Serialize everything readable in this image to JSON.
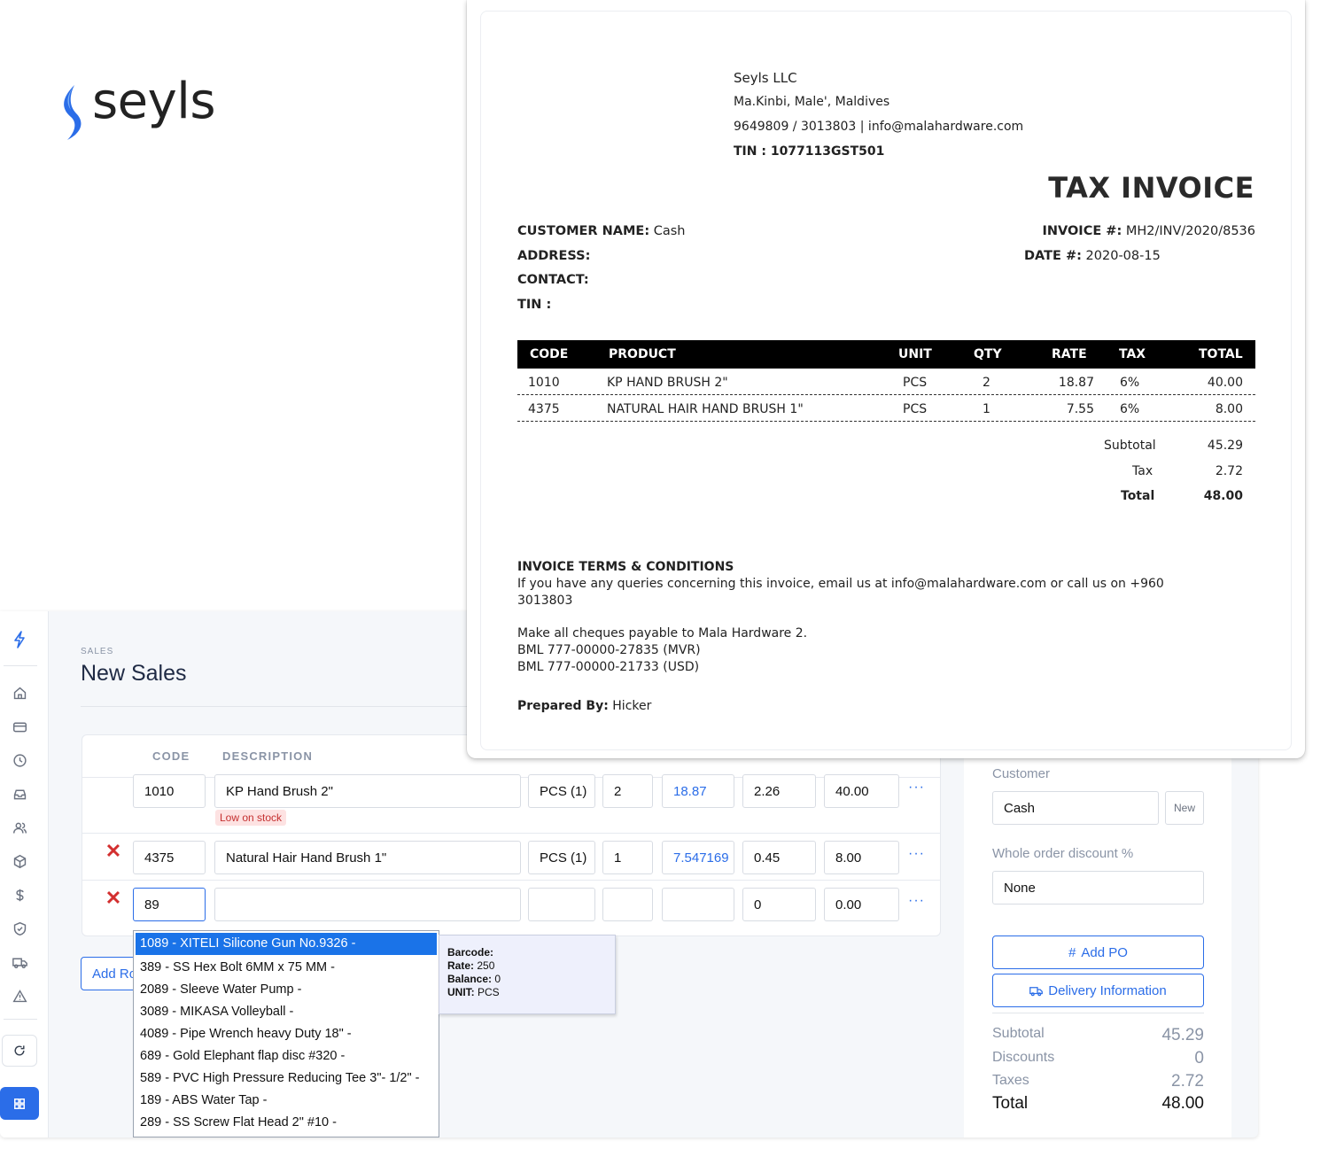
{
  "invoice": {
    "logo_text": "seyls",
    "company": "Seyls LLC",
    "address": "Ma.Kinbi, Male', Maldives",
    "contact_line": "9649809 / 3013803 | info@malahardware.com",
    "tin_label": "TIN :",
    "tin_value": "1077113GST501",
    "title": "TAX INVOICE",
    "customer_name_label": "CUSTOMER NAME:",
    "customer_name": "Cash",
    "address_label": "ADDRESS:",
    "contact_label": "CONTACT:",
    "tin2_label": "TIN :",
    "invoice_no_label": "INVOICE #:",
    "invoice_no": "MH2/INV/2020/8536",
    "date_label": "DATE #:",
    "date": "2020-08-15",
    "columns": [
      "CODE",
      "PRODUCT",
      "UNIT",
      "QTY",
      "RATE",
      "TAX",
      "TOTAL"
    ],
    "rows": [
      {
        "code": "1010",
        "product": "KP HAND BRUSH 2\"",
        "unit": "PCS",
        "qty": "2",
        "rate": "18.87",
        "tax": "6%",
        "total": "40.00"
      },
      {
        "code": "4375",
        "product": "NATURAL HAIR HAND BRUSH 1\"",
        "unit": "PCS",
        "qty": "1",
        "rate": "7.55",
        "tax": "6%",
        "total": "8.00"
      }
    ],
    "subtotal_label": "Subtotal",
    "subtotal": "45.29",
    "tax_label": "Tax",
    "tax": "2.72",
    "total_label": "Total",
    "total": "48.00",
    "terms_title": "INVOICE TERMS & CONDITIONS",
    "terms_line1": "If you have any queries concerning this invoice, email us at info@malahardware.com or call us on +960",
    "terms_line2": "3013803",
    "cheque_line": "Make all cheques payable to Mala Hardware 2.",
    "bml_mvr": "BML 777-00000-27835 (MVR)",
    "bml_usd": "BML 777-00000-21733 (USD)",
    "prepared_label": "Prepared By:",
    "prepared_by": "Hicker"
  },
  "app": {
    "breadcrumb": "SALES",
    "title": "New Sales",
    "columns": {
      "code": "CODE",
      "description": "DESCRIPTION"
    },
    "rows": [
      {
        "code": "1010",
        "description": "KP Hand Brush 2\"",
        "unit": "PCS (1)",
        "qty": "2",
        "rate": "18.87",
        "tax": "2.26",
        "total": "40.00",
        "badge": "Low on stock"
      },
      {
        "code": "4375",
        "description": "Natural Hair Hand Brush 1\"",
        "unit": "PCS (1)",
        "qty": "1",
        "rate": "7.547169",
        "tax": "0.45",
        "total": "8.00"
      },
      {
        "code": "89",
        "description": "",
        "unit": "",
        "qty": "",
        "rate": "",
        "tax": "0",
        "total": "0.00"
      }
    ],
    "more_label": "···",
    "remove_label": "✕",
    "add_row_label": "Add Row",
    "autocomplete": [
      "1089 - XITELI Silicone Gun No.9326 -",
      "389 - SS Hex Bolt 6MM x 75 MM -",
      "2089 - Sleeve Water Pump -",
      "3089 - MIKASA Volleyball -",
      "4089 - Pipe Wrench heavy Duty 18\" -",
      "689 - Gold Elephant flap disc #320 -",
      "589 - PVC High Pressure Reducing Tee 3\"- 1/2\" -",
      "189 - ABS Water Tap -",
      "289 - SS Screw Flat Head 2\" #10 -"
    ],
    "tooltip": {
      "barcode_label": "Barcode:",
      "barcode": "",
      "rate_label": "Rate:",
      "rate": "250",
      "balance_label": "Balance:",
      "balance": "0",
      "unit_label": "UNIT:",
      "unit": "PCS"
    },
    "panel": {
      "customer_label": "Customer",
      "customer_value": "Cash",
      "new_label": "New",
      "discount_label": "Whole order discount %",
      "discount_value": "None",
      "add_po_label": "Add PO",
      "delivery_label": "Delivery Information",
      "subtotal_label": "Subtotal",
      "subtotal": "45.29",
      "discounts_label": "Discounts",
      "discounts": "0",
      "taxes_label": "Taxes",
      "taxes": "2.72",
      "total_label": "Total",
      "total": "48.00"
    },
    "accent_color": "#2b6de8",
    "sidebar_icons": [
      "bolt-icon",
      "home-icon",
      "card-icon",
      "clock-icon",
      "inbox-icon",
      "users-icon",
      "box-icon",
      "dollar-icon",
      "shield-icon",
      "truck-icon",
      "warning-icon",
      "refresh-icon",
      "grid-icon"
    ]
  }
}
